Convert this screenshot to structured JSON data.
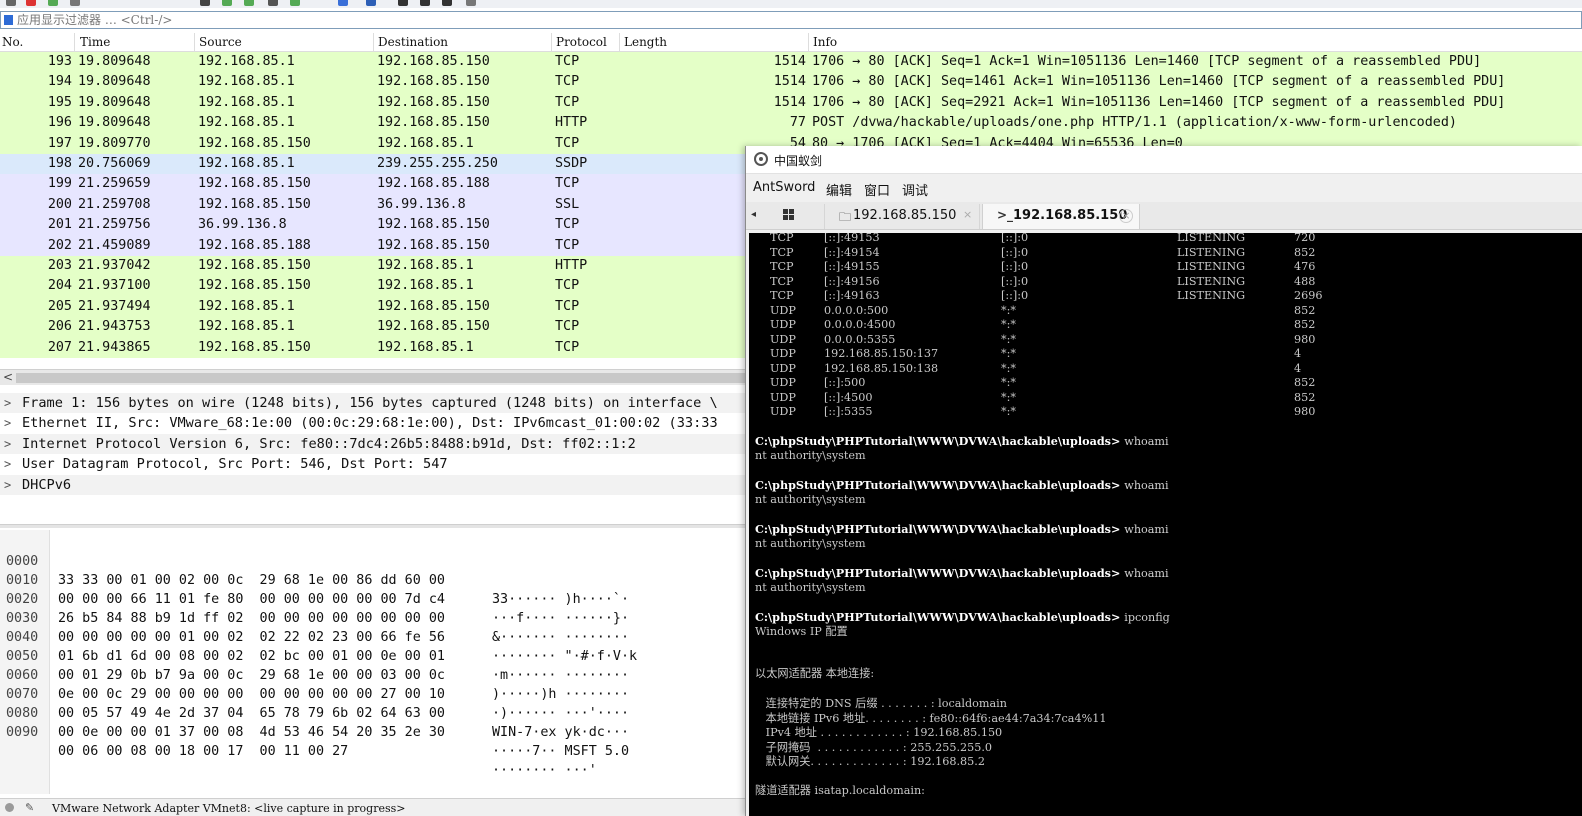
{
  "wireshark": {
    "filter": {
      "placeholder": "应用显示过滤器 … <Ctrl-/>"
    },
    "columns": {
      "no": "No.",
      "time": "Time",
      "source": "Source",
      "destination": "Destination",
      "protocol": "Protocol",
      "length": "Length",
      "info": "Info"
    },
    "colors": {
      "green": "#e4ffc7",
      "light_blue": "#dae9fb",
      "lavender": "#e7e6ff"
    },
    "packets": [
      {
        "no": "193",
        "time": "19.809648",
        "src": "192.168.85.1",
        "dst": "192.168.85.150",
        "proto": "TCP",
        "len": "1514",
        "info": "1706 → 80 [ACK] Seq=1 Ack=1 Win=1051136 Len=1460 [TCP segment of a reassembled PDU]",
        "color": "#e4ffc7"
      },
      {
        "no": "194",
        "time": "19.809648",
        "src": "192.168.85.1",
        "dst": "192.168.85.150",
        "proto": "TCP",
        "len": "1514",
        "info": "1706 → 80 [ACK] Seq=1461 Ack=1 Win=1051136 Len=1460 [TCP segment of a reassembled PDU]",
        "color": "#e4ffc7"
      },
      {
        "no": "195",
        "time": "19.809648",
        "src": "192.168.85.1",
        "dst": "192.168.85.150",
        "proto": "TCP",
        "len": "1514",
        "info": "1706 → 80 [ACK] Seq=2921 Ack=1 Win=1051136 Len=1460 [TCP segment of a reassembled PDU]",
        "color": "#e4ffc7"
      },
      {
        "no": "196",
        "time": "19.809648",
        "src": "192.168.85.1",
        "dst": "192.168.85.150",
        "proto": "HTTP",
        "len": "77",
        "info": "POST /dvwa/hackable/uploads/one.php HTTP/1.1  (application/x-www-form-urlencoded)",
        "color": "#e4ffc7"
      },
      {
        "no": "197",
        "time": "19.809770",
        "src": "192.168.85.150",
        "dst": "192.168.85.1",
        "proto": "TCP",
        "len": "54",
        "info": "80 → 1706 [ACK] Seq=1 Ack=4404 Win=65536 Len=0",
        "color": "#e4ffc7"
      },
      {
        "no": "198",
        "time": "20.756069",
        "src": "192.168.85.1",
        "dst": "239.255.255.250",
        "proto": "SSDP",
        "len": "",
        "info": "",
        "color": "#dae9fb"
      },
      {
        "no": "199",
        "time": "21.259659",
        "src": "192.168.85.150",
        "dst": "192.168.85.188",
        "proto": "TCP",
        "len": "",
        "info": "",
        "color": "#e7e6ff"
      },
      {
        "no": "200",
        "time": "21.259708",
        "src": "192.168.85.150",
        "dst": "36.99.136.8",
        "proto": "SSL",
        "len": "",
        "info": "",
        "color": "#e7e6ff"
      },
      {
        "no": "201",
        "time": "21.259756",
        "src": "36.99.136.8",
        "dst": "192.168.85.150",
        "proto": "TCP",
        "len": "",
        "info": "",
        "color": "#e7e6ff"
      },
      {
        "no": "202",
        "time": "21.459089",
        "src": "192.168.85.188",
        "dst": "192.168.85.150",
        "proto": "TCP",
        "len": "",
        "info": "",
        "color": "#e7e6ff"
      },
      {
        "no": "203",
        "time": "21.937042",
        "src": "192.168.85.150",
        "dst": "192.168.85.1",
        "proto": "HTTP",
        "len": "",
        "info": "",
        "color": "#e4ffc7"
      },
      {
        "no": "204",
        "time": "21.937100",
        "src": "192.168.85.150",
        "dst": "192.168.85.1",
        "proto": "TCP",
        "len": "",
        "info": "",
        "color": "#e4ffc7"
      },
      {
        "no": "205",
        "time": "21.937494",
        "src": "192.168.85.1",
        "dst": "192.168.85.150",
        "proto": "TCP",
        "len": "",
        "info": "",
        "color": "#e4ffc7"
      },
      {
        "no": "206",
        "time": "21.943753",
        "src": "192.168.85.1",
        "dst": "192.168.85.150",
        "proto": "TCP",
        "len": "",
        "info": "",
        "color": "#e4ffc7"
      },
      {
        "no": "207",
        "time": "21.943865",
        "src": "192.168.85.150",
        "dst": "192.168.85.1",
        "proto": "TCP",
        "len": "",
        "info": "",
        "color": "#e4ffc7"
      }
    ],
    "scroll_left_arrow": "<",
    "details": [
      "Frame 1: 156 bytes on wire (1248 bits), 156 bytes captured (1248 bits) on interface \\",
      "Ethernet II, Src: VMware_68:1e:00 (00:0c:29:68:1e:00), Dst: IPv6mcast_01:00:02 (33:33",
      "Internet Protocol Version 6, Src: fe80::7dc4:26b5:8488:b91d, Dst: ff02::1:2",
      "User Datagram Protocol, Src Port: 546, Dst Port: 547",
      "DHCPv6"
    ],
    "expander": ">",
    "bytes": [
      {
        "off": "0000",
        "hex": "33 33 00 01 00 02 00 0c  29 68 1e 00 86 dd 60 00",
        "ascii": "33······ )h····`·"
      },
      {
        "off": "0010",
        "hex": "00 00 00 66 11 01 fe 80  00 00 00 00 00 00 7d c4",
        "ascii": "···f···· ······}·"
      },
      {
        "off": "0020",
        "hex": "26 b5 84 88 b9 1d ff 02  00 00 00 00 00 00 00 00",
        "ascii": "&······· ········"
      },
      {
        "off": "0030",
        "hex": "00 00 00 00 00 01 00 02  02 22 02 23 00 66 fe 56",
        "ascii": "········ \"·#·f·V·k"
      },
      {
        "off": "0040",
        "hex": "01 6b d1 6d 00 08 00 02  02 bc 00 01 00 0e 00 01",
        "ascii": "·m······ ········"
      },
      {
        "off": "0050",
        "hex": "00 01 29 0b b7 9a 00 0c  29 68 1e 00 00 03 00 0c",
        "ascii": ")·····)h ········"
      },
      {
        "off": "0060",
        "hex": "0e 00 0c 29 00 00 00 00  00 00 00 00 00 27 00 10",
        "ascii": "·)······ ···'····"
      },
      {
        "off": "0070",
        "hex": "00 05 57 49 4e 2d 37 04  65 78 79 6b 02 64 63 00",
        "ascii": "WIN-7·ex yk·dc···"
      },
      {
        "off": "0080",
        "hex": "00 0e 00 00 01 37 00 08  4d 53 46 54 20 35 2e 30",
        "ascii": "·····7·· MSFT 5.0"
      },
      {
        "off": "0090",
        "hex": "00 06 00 08 00 18 00 17  00 11 00 27",
        "ascii": "········ ···'"
      }
    ],
    "status": {
      "edit_glyph": "✎",
      "message": "VMware Network Adapter VMnet8: <live capture in progress>"
    }
  },
  "antsword": {
    "title": "中国蚁剑",
    "menu": [
      "AntSword",
      "编辑",
      "窗口",
      "调试"
    ],
    "tabs": [
      {
        "icon": "folder-icon",
        "glyph": "🗀",
        "label": "192.168.85.150",
        "close": "×"
      },
      {
        "icon": "terminal-icon",
        "glyph": ">_",
        "label": "192.168.85.150",
        "close": "×"
      }
    ],
    "tab_scroll_left": "◂",
    "netstat": [
      {
        "proto": "TCP",
        "local": "[::]:49153",
        "foreign": "[::]:0",
        "state": "LISTENING",
        "pid": "720"
      },
      {
        "proto": "TCP",
        "local": "[::]:49154",
        "foreign": "[::]:0",
        "state": "LISTENING",
        "pid": "852"
      },
      {
        "proto": "TCP",
        "local": "[::]:49155",
        "foreign": "[::]:0",
        "state": "LISTENING",
        "pid": "476"
      },
      {
        "proto": "TCP",
        "local": "[::]:49156",
        "foreign": "[::]:0",
        "state": "LISTENING",
        "pid": "488"
      },
      {
        "proto": "TCP",
        "local": "[::]:49163",
        "foreign": "[::]:0",
        "state": "LISTENING",
        "pid": "2696"
      },
      {
        "proto": "UDP",
        "local": "0.0.0.0:500",
        "foreign": "*:*",
        "state": "",
        "pid": "852"
      },
      {
        "proto": "UDP",
        "local": "0.0.0.0:4500",
        "foreign": "*:*",
        "state": "",
        "pid": "852"
      },
      {
        "proto": "UDP",
        "local": "0.0.0.0:5355",
        "foreign": "*:*",
        "state": "",
        "pid": "980"
      },
      {
        "proto": "UDP",
        "local": "192.168.85.150:137",
        "foreign": "*:*",
        "state": "",
        "pid": "4"
      },
      {
        "proto": "UDP",
        "local": "192.168.85.150:138",
        "foreign": "*:*",
        "state": "",
        "pid": "4"
      },
      {
        "proto": "UDP",
        "local": "[::]:500",
        "foreign": "*:*",
        "state": "",
        "pid": "852"
      },
      {
        "proto": "UDP",
        "local": "[::]:4500",
        "foreign": "*:*",
        "state": "",
        "pid": "852"
      },
      {
        "proto": "UDP",
        "local": "[::]:5355",
        "foreign": "*:*",
        "state": "",
        "pid": "980"
      }
    ],
    "prompt_path": "C:\\phpStudy\\PHPTutorial\\WWW\\DVWA\\hackable\\uploads>",
    "sessions": [
      {
        "cmd": "whoami",
        "output": "nt authority\\system"
      },
      {
        "cmd": "whoami",
        "output": "nt authority\\system"
      },
      {
        "cmd": "whoami",
        "output": "nt authority\\system"
      },
      {
        "cmd": "whoami",
        "output": "nt authority\\system"
      },
      {
        "cmd": "ipconfig",
        "output": "Windows IP 配置"
      }
    ],
    "ipconfig": {
      "adapter_header": "以太网适配器 本地连接:",
      "lines": [
        "   连接特定的 DNS 后缀 . . . . . . . : localdomain",
        "   本地链接 IPv6 地址. . . . . . . . : fe80::64f6:ae44:7a34:7ca4%11",
        "   IPv4 地址 . . . . . . . . . . . . : 192.168.85.150",
        "   子网掩码  . . . . . . . . . . . . : 255.255.255.0",
        "   默认网关. . . . . . . . . . . . . : 192.168.85.2"
      ],
      "tunnel_header": "隧道适配器 isatap.localdomain:"
    }
  }
}
